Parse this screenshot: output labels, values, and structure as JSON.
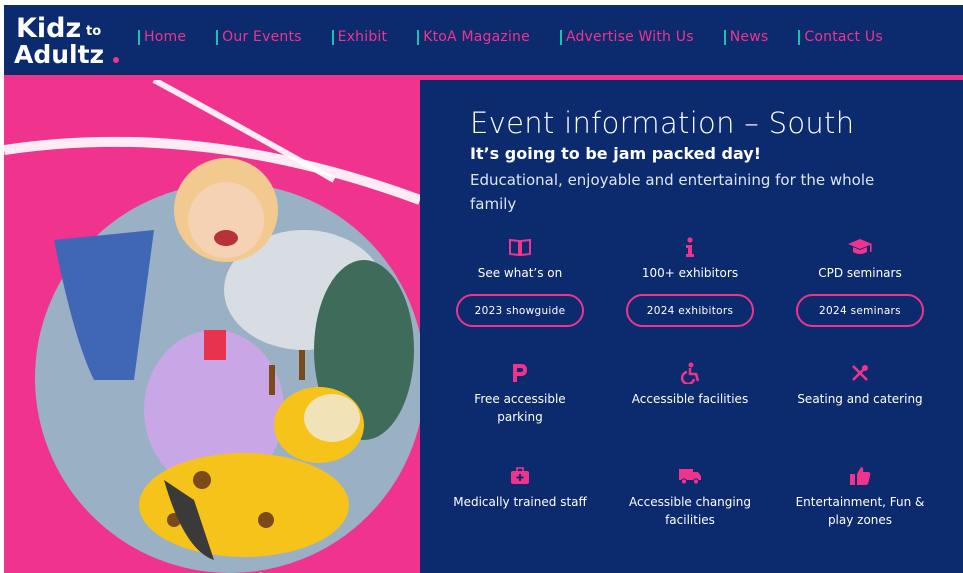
{
  "brand": {
    "logo_line1": "Kidz",
    "logo_to": "to",
    "logo_line2": "Adultz"
  },
  "nav": {
    "home": "Home",
    "events": "Our Events",
    "exhibit": "Exhibit",
    "magazine": "KtoA Magazine",
    "advertise": "Advertise With Us",
    "news": "News",
    "contact": "Contact Us"
  },
  "colors": {
    "navy": "#0c2a6e",
    "pink": "#f0348d",
    "teal": "#19c3b0"
  },
  "hero": {
    "image": "photo of a smiling child riding a yellow giraffe ride-on toy"
  },
  "info": {
    "title": "Event information – South",
    "subtitle": "It’s going to be jam packed day!",
    "description": "Educational, enjoyable and entertaining for the whole family"
  },
  "features": {
    "whats_on": {
      "icon": "book-icon",
      "label": "See what’s on",
      "button": "2023 showguide"
    },
    "exhibitors": {
      "icon": "info-icon",
      "label": "100+ exhibitors",
      "button": "2024 exhibitors"
    },
    "cpd": {
      "icon": "graduation-cap-icon",
      "label": "CPD seminars",
      "button": "2024 seminars"
    },
    "parking": {
      "icon": "parking-icon",
      "label": "Free accessible parking"
    },
    "accessible": {
      "icon": "wheelchair-icon",
      "label": "Accessible facilities"
    },
    "catering": {
      "icon": "utensils-icon",
      "label": "Seating and catering"
    },
    "medical": {
      "icon": "first-aid-kit-icon",
      "label": "Medically trained staff"
    },
    "changing": {
      "icon": "van-icon",
      "label": "Accessible changing facilities"
    },
    "entertainment": {
      "icon": "thumbs-up-icon",
      "label": "Entertainment, Fun & play zones"
    }
  }
}
